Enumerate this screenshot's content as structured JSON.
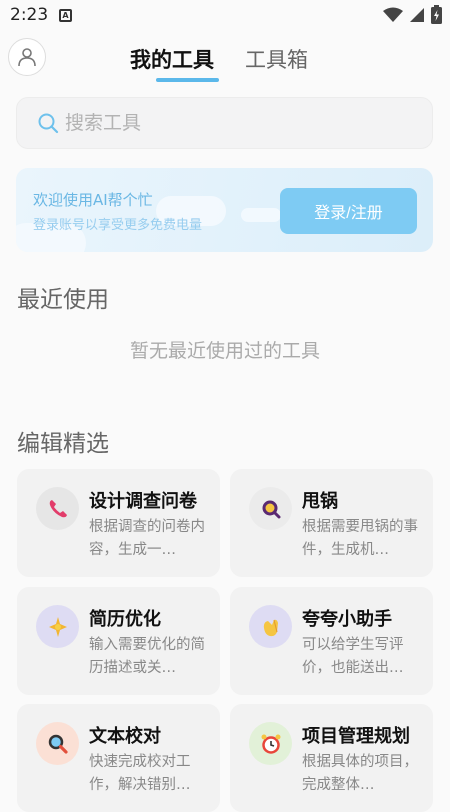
{
  "status_bar": {
    "time": "2:23",
    "notif_letter": "A"
  },
  "header": {
    "tabs": [
      {
        "label": "我的工具"
      },
      {
        "label": "工具箱"
      }
    ]
  },
  "search": {
    "placeholder": "搜索工具"
  },
  "banner": {
    "title": "欢迎使用AI帮个忙",
    "subtitle": "登录账号以享受更多免费电量",
    "button": "登录/注册"
  },
  "recent": {
    "title": "最近使用",
    "empty_text": "暂无最近使用过的工具"
  },
  "picks": {
    "title": "编辑精选",
    "cards": [
      {
        "name": "设计调查问卷",
        "desc": "根据调查的问卷内容，生成一…",
        "icon": "phone-icon",
        "bg": "#e8e8e8"
      },
      {
        "name": "甩锅",
        "desc": "根据需要甩锅的事件，生成机…",
        "icon": "magnifier-icon",
        "bg": "#ededed"
      },
      {
        "name": "简历优化",
        "desc": "输入需要优化的简历描述或关…",
        "icon": "sparkle-icon",
        "bg": "#e2e0f5"
      },
      {
        "name": "夸夸小助手",
        "desc": "可以给学生写评价，也能送出…",
        "icon": "clap-icon",
        "bg": "#e2e0f5"
      },
      {
        "name": "文本校对",
        "desc": "快速完成校对工作，解决错别…",
        "icon": "search-icon",
        "bg": "#fbe2d8"
      },
      {
        "name": "项目管理规划",
        "desc": "根据具体的项目，完成整体…",
        "icon": "alarm-clock-icon",
        "bg": "#e5f3dc"
      }
    ]
  }
}
